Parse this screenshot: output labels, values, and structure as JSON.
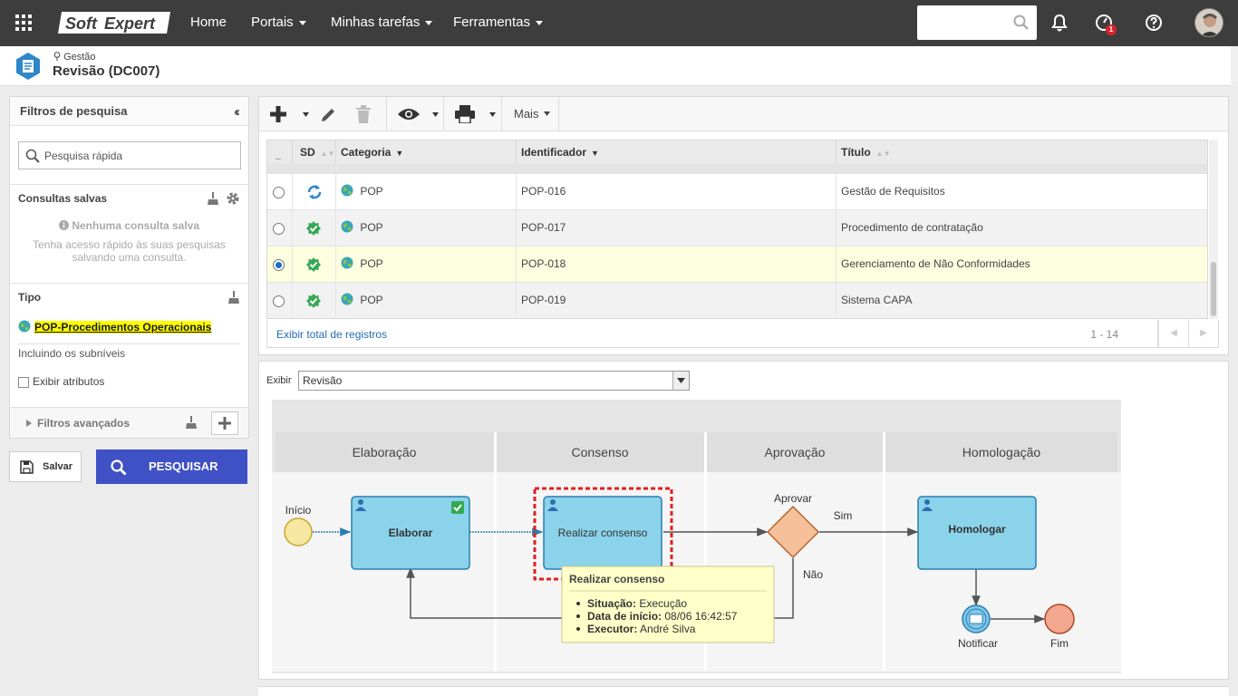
{
  "topbar": {
    "brand": "SoftExpert",
    "brand_left": "Soft",
    "brand_right": "Expert",
    "nav": [
      {
        "label": "Home",
        "dropdown": false
      },
      {
        "label": "Portais",
        "dropdown": true
      },
      {
        "label": "Minhas tarefas",
        "dropdown": true
      },
      {
        "label": "Ferramentas",
        "dropdown": true
      }
    ],
    "search_value": "",
    "notification_badge": "1",
    "colors": {
      "bar": "#3d3d3d",
      "badge": "#d9232d"
    }
  },
  "header": {
    "breadcrumb": "Gestão",
    "title": "Revisão (DC007)",
    "icon": "document-list-icon"
  },
  "filters": {
    "title": "Filtros de pesquisa",
    "quick_search_placeholder": "Pesquisa rápida",
    "saved_queries": {
      "title": "Consultas salvas",
      "empty_title": "Nenhuma consulta salva",
      "empty_desc": "Tenha acesso rápido às suas pesquisas salvando uma consulta."
    },
    "type": {
      "title": "Tipo",
      "value": "POP-Procedimentos Operacionais",
      "sublevels": "Incluindo os subníveis"
    },
    "show_attributes": "Exibir atributos",
    "show_attributes_checked": false,
    "advanced": "Filtros avançados",
    "save_label": "Salvar",
    "search_label": "PESQUISAR",
    "search_color": "#3f51c4"
  },
  "grid": {
    "toolbar": {
      "more_label": "Mais"
    },
    "columns": {
      "sd": "SD",
      "category": "Categoria",
      "identifier": "Identificador",
      "title": "Título"
    },
    "rows": [
      {
        "status": "revision-sync-icon",
        "category": "POP",
        "identifier": "POP-016",
        "title": "Gestão de Requisitos",
        "selected": false
      },
      {
        "status": "approved-check-icon",
        "category": "POP",
        "identifier": "POP-017",
        "title": "Procedimento de contratação",
        "selected": false
      },
      {
        "status": "approved-check-icon",
        "category": "POP",
        "identifier": "POP-018",
        "title": "Gerenciamento de Não Conformidades",
        "selected": true
      },
      {
        "status": "approved-check-icon",
        "category": "POP",
        "identifier": "POP-019",
        "title": "Sistema CAPA",
        "selected": false
      }
    ],
    "footer_link": "Exibir total de registros",
    "range": "1 - 14",
    "selected_row_color": "#fdfde0"
  },
  "diagram": {
    "show_label": "Exibir",
    "show_value": "Revisão",
    "lanes": [
      "Elaboração",
      "Consenso",
      "Aprovação",
      "Homologação"
    ],
    "start_label": "Início",
    "tasks": {
      "elaborar": "Elaborar",
      "consenso": "Realizar consenso",
      "homologar": "Homologar"
    },
    "gateway_label": "Aprovar",
    "yes_label": "Sim",
    "no_label": "Não",
    "notify_label": "Notificar",
    "end_label": "Fim",
    "tooltip": {
      "title": "Realizar consenso",
      "items": [
        {
          "label": "Situação:",
          "value": "Execução"
        },
        {
          "label": "Data de início:",
          "value": "08/06 16:42:57"
        },
        {
          "label": "Executor:",
          "value": "André Silva"
        }
      ]
    },
    "colors": {
      "task": "#8bd3ea",
      "task_border": "#2a7fb0",
      "gateway": "#f5c09a",
      "start": "#f6e7a1",
      "end": "#f4a78f",
      "highlight": "#e02020"
    }
  }
}
